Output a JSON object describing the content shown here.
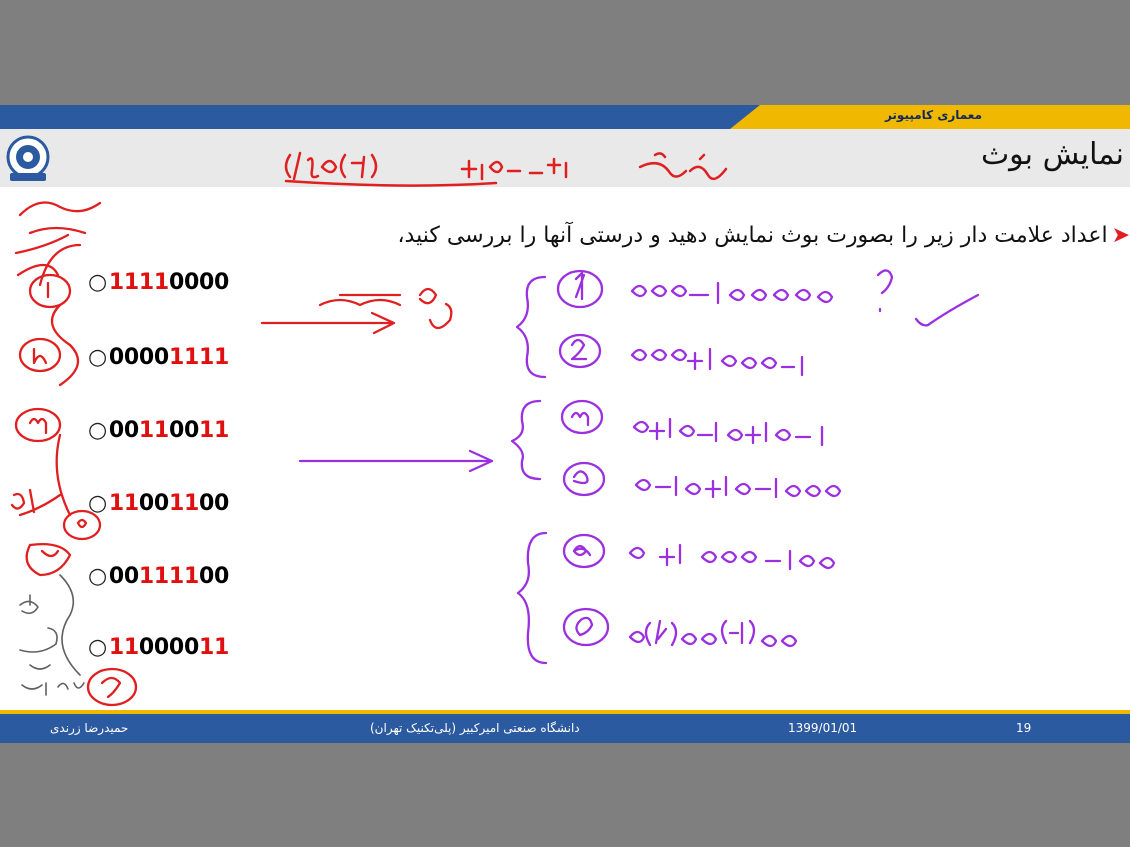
{
  "header": {
    "course_title": "معماری کامپیوتر",
    "slide_title": "نمایش بوث"
  },
  "content": {
    "bullet_text": "اعداد علامت دار زیر را بصورت بوث نمایش دهید و درستی آنها را بررسی کنید،",
    "items": [
      {
        "black": "111",
        "red": "10000",
        "lead_red": true
      },
      {
        "black": "0000",
        "red": "1111",
        "lead_red": false
      },
      {
        "black": "00",
        "red": "11",
        "tail_black": "00",
        "tail_red": "11",
        "lead_red": false
      },
      {
        "black": "11",
        "red": "00",
        "tail_black": "11",
        "tail_red": "00",
        "lead_red": true
      },
      {
        "black": "00",
        "red": "1111",
        "tail_black": "00",
        "lead_red": false
      },
      {
        "black": "11",
        "red": "0000",
        "tail_black": "11",
        "lead_red": true
      }
    ],
    "item_texts": [
      "11110000",
      "00001111",
      "00110011",
      "11001100",
      "00111100",
      "11000011"
    ]
  },
  "footer": {
    "author": "حمیدرضا زرندی",
    "university": "دانشگاه صنعتی امیرکبیر (پلی‌تکنیک تهران)",
    "date": "1399/01/01",
    "page_number": "19"
  },
  "colors": {
    "header_blue": "#2c5aa0",
    "gold": "#f0b800",
    "title_bar": "#e9e9e9",
    "red_digit": "#e01010",
    "ink_red": "#e02020",
    "ink_purple": "#9b30e0"
  }
}
